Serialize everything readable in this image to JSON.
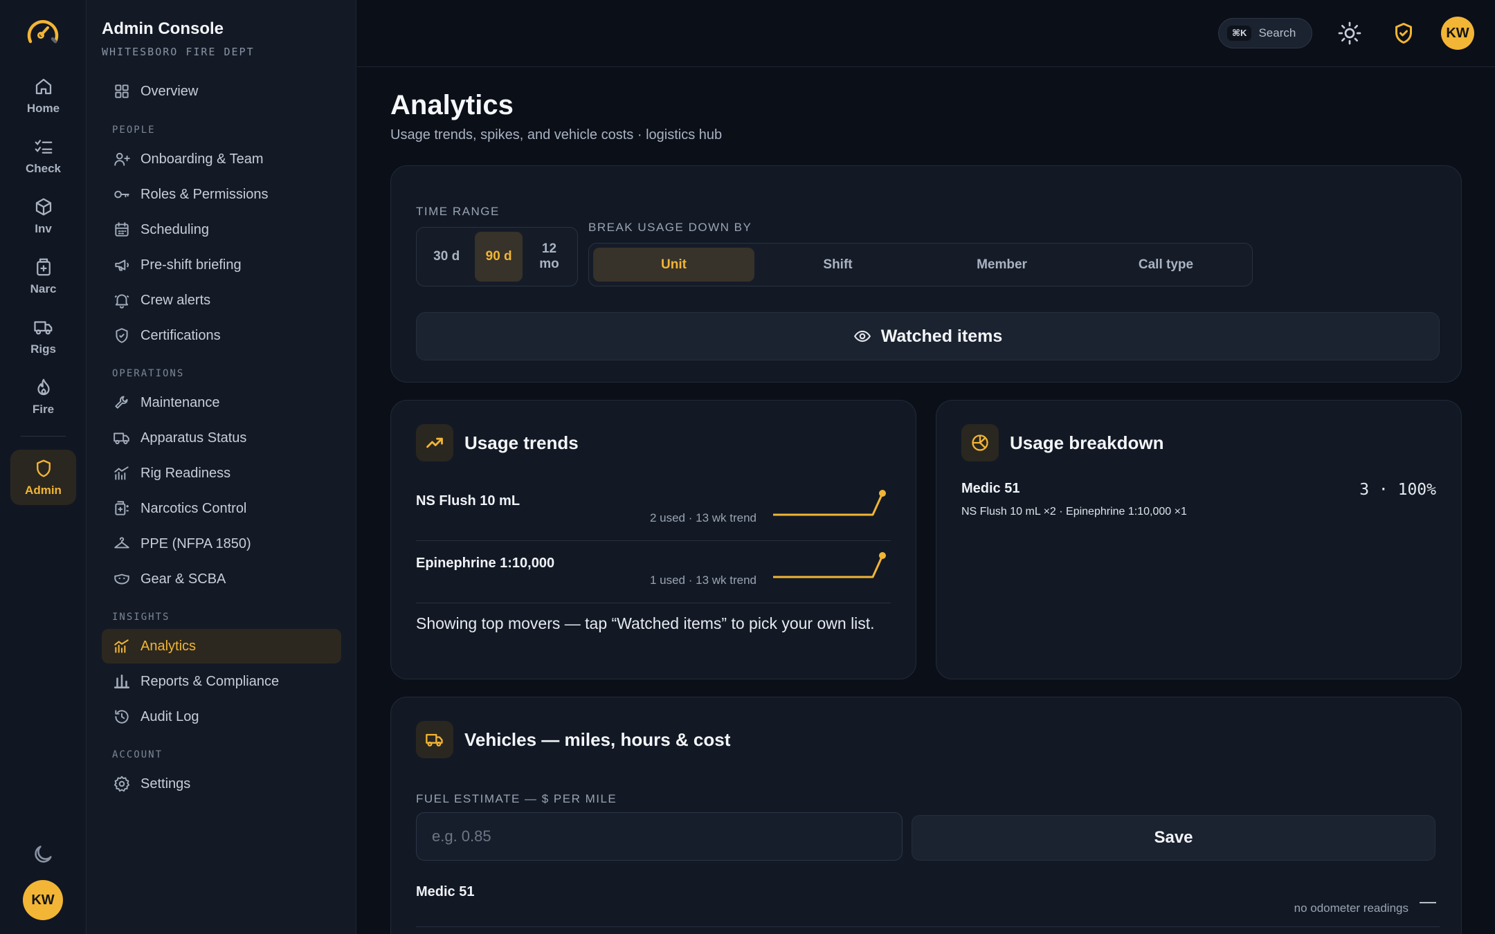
{
  "rail": {
    "items": [
      {
        "label": "Home",
        "icon": "home-icon"
      },
      {
        "label": "Check",
        "icon": "checklist-icon"
      },
      {
        "label": "Inv",
        "icon": "box-icon"
      },
      {
        "label": "Narc",
        "icon": "medkit-icon"
      },
      {
        "label": "Rigs",
        "icon": "truck-icon"
      },
      {
        "label": "Fire",
        "icon": "flame-icon"
      },
      {
        "label": "Admin",
        "icon": "shield-icon",
        "active": true
      }
    ],
    "avatar_initials": "KW"
  },
  "sidebar": {
    "title": "Admin Console",
    "subtitle": "WHITESBORO FIRE DEPT",
    "overview": "Overview",
    "sections": {
      "people": "PEOPLE",
      "operations": "OPERATIONS",
      "insights": "INSIGHTS",
      "account": "ACCOUNT"
    },
    "people_items": [
      "Onboarding & Team",
      "Roles & Permissions",
      "Scheduling",
      "Pre-shift briefing",
      "Crew alerts",
      "Certifications"
    ],
    "operations_items": [
      "Maintenance",
      "Apparatus Status",
      "Rig Readiness",
      "Narcotics Control",
      "PPE (NFPA 1850)",
      "Gear & SCBA"
    ],
    "insights_items": [
      "Analytics",
      "Reports & Compliance",
      "Audit Log"
    ],
    "account_items": [
      "Settings"
    ],
    "active_item": "Analytics"
  },
  "topbar": {
    "search_kbd": "⌘K",
    "search_label": "Search",
    "avatar_initials": "KW"
  },
  "page": {
    "title": "Analytics",
    "subtitle": "Usage trends, spikes, and vehicle costs · logistics hub"
  },
  "filters": {
    "time_range_label": "TIME RANGE",
    "time_ranges": [
      "30 d",
      "90 d",
      "12 mo"
    ],
    "time_range_selected": "90 d",
    "breakdown_label": "BREAK USAGE DOWN BY",
    "breakdowns": [
      "Unit",
      "Shift",
      "Member",
      "Call type"
    ],
    "breakdown_selected": "Unit",
    "watched_label": "Watched items"
  },
  "usage_trends": {
    "title": "Usage trends",
    "items": [
      {
        "name": "NS Flush 10 mL",
        "meta": "2 used · 13 wk trend"
      },
      {
        "name": "Epinephrine 1:10,000",
        "meta": "1 used · 13 wk trend"
      }
    ],
    "note": "Showing top movers — tap “Watched items” to pick your own list."
  },
  "usage_breakdown": {
    "title": "Usage breakdown",
    "unit": "Medic 51",
    "detail": "NS Flush 10 mL ×2 · Epinephrine 1:10,000 ×1",
    "stat": "3 · 100%"
  },
  "vehicles": {
    "title": "Vehicles — miles, hours & cost",
    "fuel_label": "FUEL ESTIMATE — $ PER MILE",
    "fuel_placeholder": "e.g. 0.85",
    "fuel_value": "",
    "save_label": "Save",
    "rows": [
      {
        "name": "Medic 51",
        "note": "no odometer readings",
        "value": "—"
      }
    ]
  },
  "colors": {
    "accent": "#f2b535",
    "background": "#0b0f18",
    "card": "#121925"
  }
}
